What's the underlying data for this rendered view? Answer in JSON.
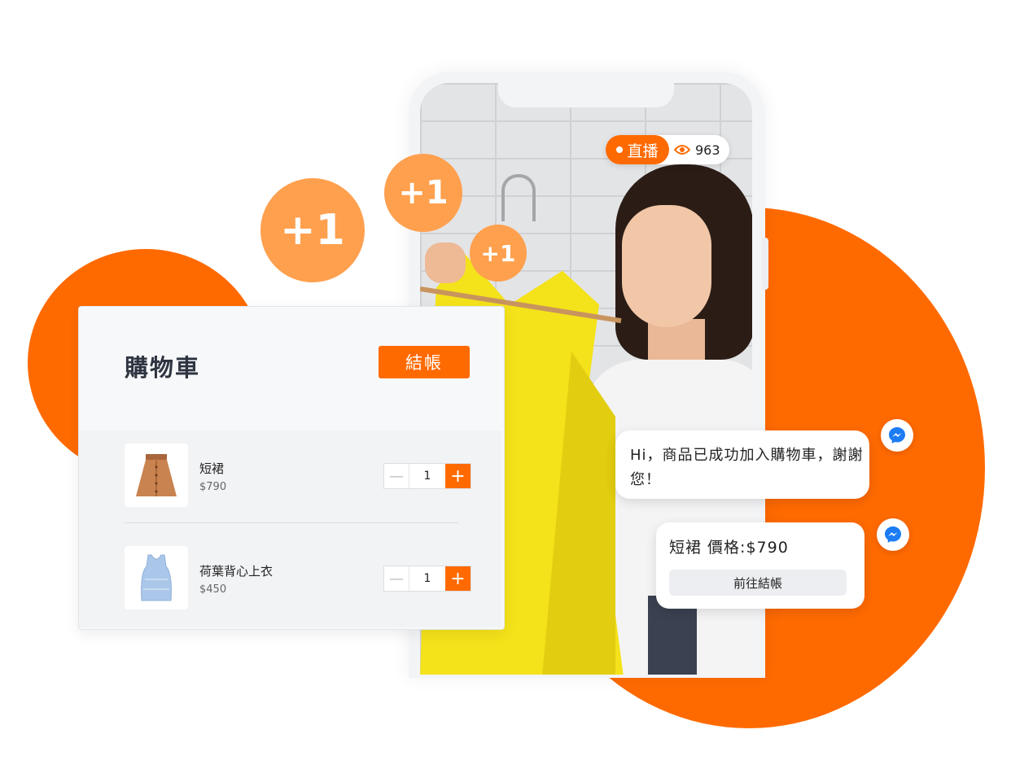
{
  "colors": {
    "accent": "#ff6a00",
    "plus_bubble": "#ffa04e",
    "messenger": "#1c7cf4"
  },
  "live": {
    "label": "直播",
    "viewers": "963",
    "icon": "eye-icon"
  },
  "plus_bubbles": [
    "+1",
    "+1",
    "+1"
  ],
  "cart": {
    "title": "購物車",
    "checkout_label": "結帳",
    "items": [
      {
        "name": "短裙",
        "price": "$790",
        "quantity": "1",
        "icon": "skirt-icon"
      },
      {
        "name": "荷葉背心上衣",
        "price": "$450",
        "quantity": "1",
        "icon": "tank-top-icon"
      }
    ]
  },
  "chat": {
    "message_1": "Hi，商品已成功加入購物車，謝謝您！",
    "message_2": "短裙 價格:$790",
    "message_2_button": "前往結帳",
    "icon": "messenger-icon"
  }
}
